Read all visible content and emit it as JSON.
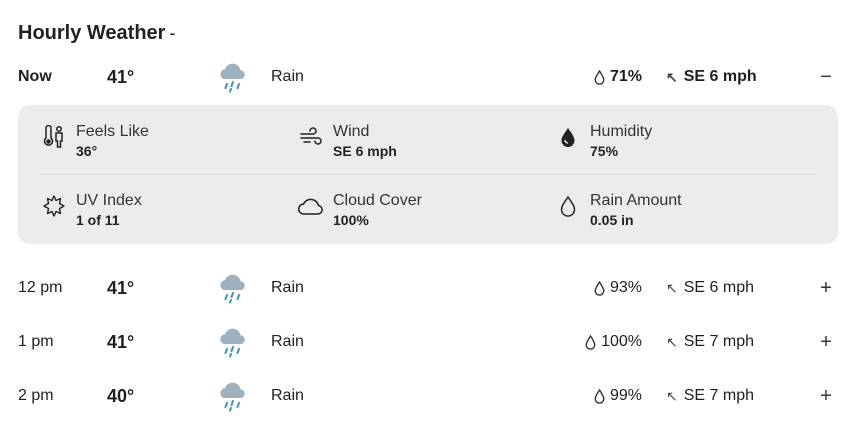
{
  "title": "Hourly Weather",
  "title_suffix": "-",
  "now_row": {
    "time": "Now",
    "temp": "41°",
    "condition": "Rain",
    "icon": "rain-cloud-icon",
    "precip": "71%",
    "wind": "SE 6 mph",
    "toggle": "−"
  },
  "details": {
    "feels_like": {
      "label": "Feels Like",
      "value": "36°",
      "icon": "thermometer-person-icon"
    },
    "wind": {
      "label": "Wind",
      "value": "SE 6 mph",
      "icon": "wind-icon"
    },
    "humidity": {
      "label": "Humidity",
      "value": "75%",
      "icon": "humidity-drop-icon"
    },
    "uv_index": {
      "label": "UV Index",
      "value": "1 of 11",
      "icon": "sun-icon"
    },
    "cloud_cover": {
      "label": "Cloud Cover",
      "value": "100%",
      "icon": "cloud-icon"
    },
    "rain_amount": {
      "label": "Rain Amount",
      "value": "0.05 in",
      "icon": "raindrop-icon"
    }
  },
  "rows": [
    {
      "time": "12 pm",
      "temp": "41°",
      "condition": "Rain",
      "icon": "rain-cloud-icon",
      "precip": "93%",
      "wind": "SE 6 mph",
      "toggle": "+"
    },
    {
      "time": "1 pm",
      "temp": "41°",
      "condition": "Rain",
      "icon": "rain-cloud-icon",
      "precip": "100%",
      "wind": "SE 7 mph",
      "toggle": "+"
    },
    {
      "time": "2 pm",
      "temp": "40°",
      "condition": "Rain",
      "icon": "rain-cloud-icon",
      "precip": "99%",
      "wind": "SE 7 mph",
      "toggle": "+"
    }
  ],
  "colors": {
    "panel_bg": "#ececec",
    "cloud": "#9fb0bf",
    "rain": "#4a98c0"
  }
}
